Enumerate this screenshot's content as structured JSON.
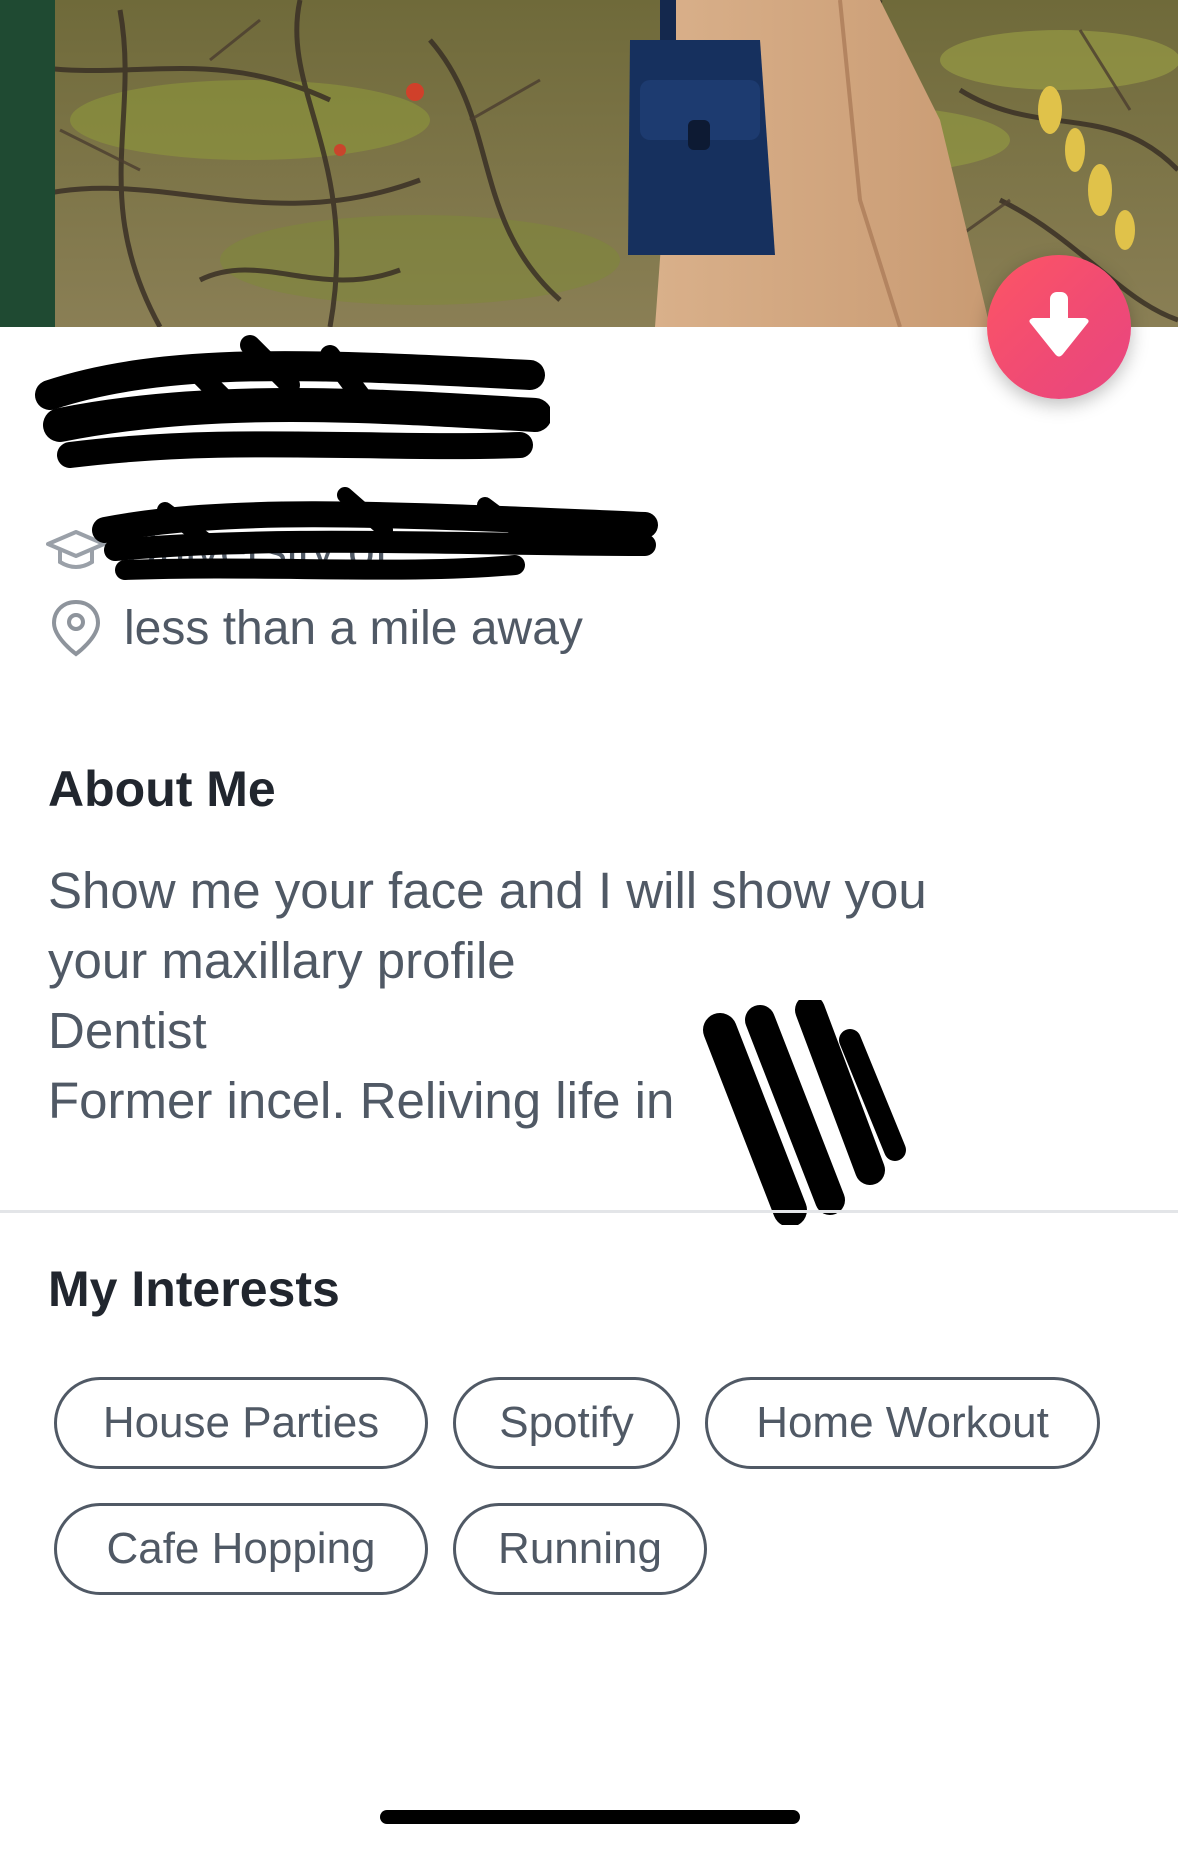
{
  "profile": {
    "school": "University of",
    "distance": "less than a mile away"
  },
  "about": {
    "title": "About Me",
    "lines": [
      "Show me your face and I will show you",
      "your maxillary profile",
      "Dentist",
      "Former incel. Reliving life in"
    ]
  },
  "interests": {
    "title": "My Interests",
    "items": [
      "House Parties",
      "Spotify",
      "Home Workout",
      "Cafe Hopping",
      "Running"
    ]
  },
  "icons": {
    "collapse": "arrow-down-icon",
    "school": "graduation-cap-icon",
    "distance": "location-pin-icon"
  },
  "colors": {
    "accent_start": "#fd5564",
    "accent_end": "#e84681",
    "text": "#505965",
    "heading": "#21262e"
  }
}
